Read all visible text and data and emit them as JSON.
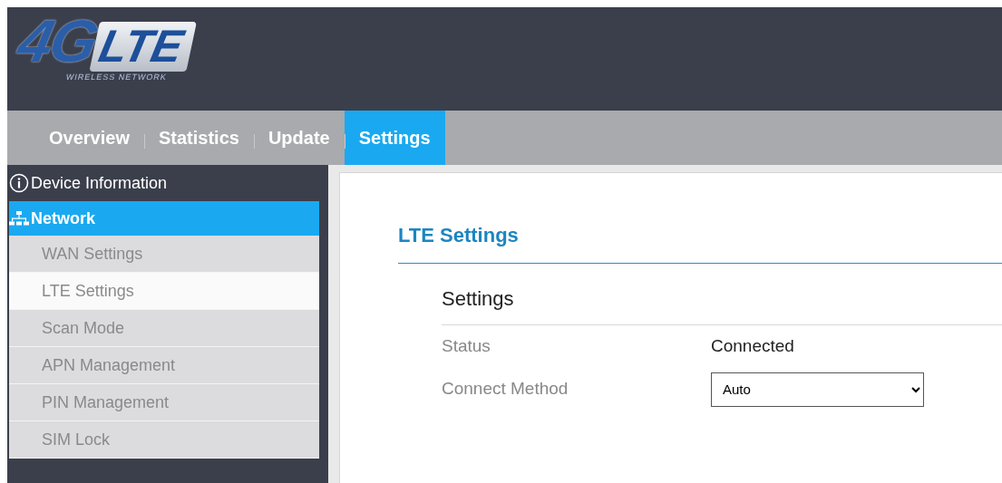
{
  "logo": {
    "mark": "4G",
    "word": "LTE",
    "tagline": "WIRELESS NETWORK"
  },
  "tabs": [
    {
      "label": "Overview",
      "selected": false
    },
    {
      "label": "Statistics",
      "selected": false
    },
    {
      "label": "Update",
      "selected": false
    },
    {
      "label": "Settings",
      "selected": true
    }
  ],
  "sidebar": {
    "groups": [
      {
        "label": "Device Information",
        "selected": false
      },
      {
        "label": "Network",
        "selected": true,
        "items": [
          {
            "label": "WAN Settings",
            "selected": false
          },
          {
            "label": "LTE Settings",
            "selected": true
          },
          {
            "label": "Scan Mode",
            "selected": false
          },
          {
            "label": "APN Management",
            "selected": false
          },
          {
            "label": "PIN Management",
            "selected": false
          },
          {
            "label": "SIM Lock",
            "selected": false
          }
        ]
      }
    ]
  },
  "page": {
    "title": "LTE Settings",
    "section": "Settings",
    "fields": [
      {
        "kind": "text",
        "label": "Status",
        "value": "Connected"
      },
      {
        "kind": "select",
        "label": "Connect Method",
        "value": "Auto"
      }
    ]
  }
}
